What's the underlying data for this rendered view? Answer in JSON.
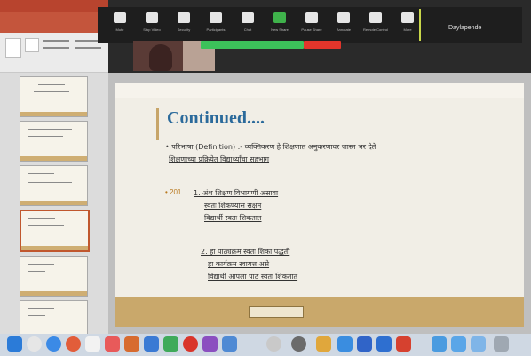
{
  "colors": {
    "ppt_brand": "#c4553c",
    "zoom_bar": "#1e1e1e",
    "recording_green": "#3cc15a",
    "recording_red": "#e2352b",
    "slide_title": "#2b6a9b",
    "slide_band": "#c9a86b"
  },
  "zoom": {
    "status_text": "Daylapende",
    "buttons": [
      {
        "name": "mute-button",
        "icon": "microphone-icon",
        "label": "Mute"
      },
      {
        "name": "stop-video-button",
        "icon": "video-camera-icon",
        "label": "Stop Video"
      },
      {
        "name": "security-button",
        "icon": "shield-icon",
        "label": "Security"
      },
      {
        "name": "participants-button",
        "icon": "people-icon",
        "label": "Participants"
      },
      {
        "name": "chat-button",
        "icon": "chat-bubble-icon",
        "label": "Chat"
      },
      {
        "name": "new-share-button",
        "icon": "share-screen-icon",
        "label": "New Share"
      },
      {
        "name": "pause-share-button",
        "icon": "pause-icon",
        "label": "Pause Share"
      },
      {
        "name": "annotate-button",
        "icon": "pencil-icon",
        "label": "Annotate"
      },
      {
        "name": "remote-control-button",
        "icon": "mouse-icon",
        "label": "Remote Control"
      },
      {
        "name": "more-button",
        "icon": "ellipsis-icon",
        "label": "More"
      }
    ]
  },
  "slide": {
    "title": "Continued....",
    "line1": "• परिभाषा (Definition) :- व्यक्तिकरण हे शिक्षणात अनुकरणावर जास्त भर देते",
    "line2": "शिक्षणाच्या प्रक्रियेत विद्यार्थ्यांचा सहभाग",
    "point_label": "• 201",
    "items": [
      "1. अंश शिक्षण विभागणी असावा",
      "स्वतः शिकण्यास सक्षम",
      "विद्यार्थी स्वतः शिकतात",
      "2. हा पाठ्यक्रम स्वतः शिका पद्धती",
      "हा कार्यक्रम स्वायत्त असे",
      "विद्यार्थी आपला पाठ स्वतः शिकतात"
    ]
  },
  "thumbnails": {
    "count": 6,
    "active_index": 3
  }
}
